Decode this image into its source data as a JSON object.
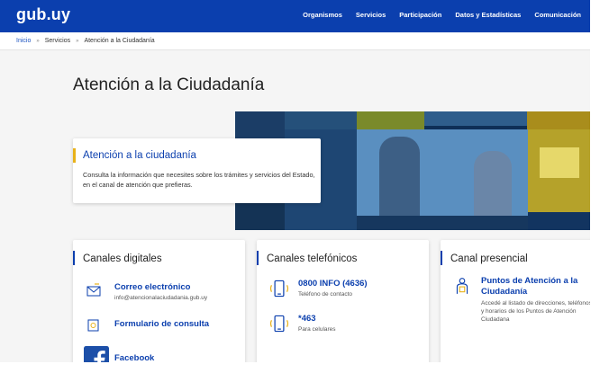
{
  "header": {
    "logo": "gub.uy",
    "nav": [
      "Organismos",
      "Servicios",
      "Participación",
      "Datos y Estadísticas",
      "Comunicación"
    ]
  },
  "breadcrumb": {
    "home": "Inicio",
    "section": "Servicios",
    "current": "Atención a la Ciudadanía",
    "separator": "»"
  },
  "page": {
    "title": "Atención a la Ciudadanía"
  },
  "intro": {
    "title": "Atención a la ciudadanía",
    "text": "Consulta la información que necesites sobre los trámites y servicios del Estado, en el canal de atención que prefieras."
  },
  "cards": {
    "digital": {
      "title": "Canales digitales",
      "email": {
        "label": "Correo electrónico",
        "value": "info@atencionalaciudadania.gub.uy",
        "icon": "envelope-icon"
      },
      "form": {
        "label": "Formulario de consulta",
        "icon": "form-icon"
      },
      "facebook": {
        "label": "Facebook",
        "icon": "facebook-icon"
      }
    },
    "phone": {
      "title": "Canales telefónicos",
      "line1": {
        "label": "0800 INFO (4636)",
        "value": "Teléfono de contacto",
        "icon": "phone-icon"
      },
      "line2": {
        "label": "*463",
        "value": "Para celulares",
        "icon": "mobile-icon"
      }
    },
    "presencial": {
      "title": "Canal presencial",
      "points": {
        "label": "Puntos de Atención a la Ciudadanía",
        "text": "Accedé al listado de direcciones, teléfonos y horarios de los Puntos de Atención Ciudadana",
        "icon": "person-info-icon"
      }
    }
  },
  "colors": {
    "brand": "#0b3fae",
    "accent": "#e8b21a"
  }
}
